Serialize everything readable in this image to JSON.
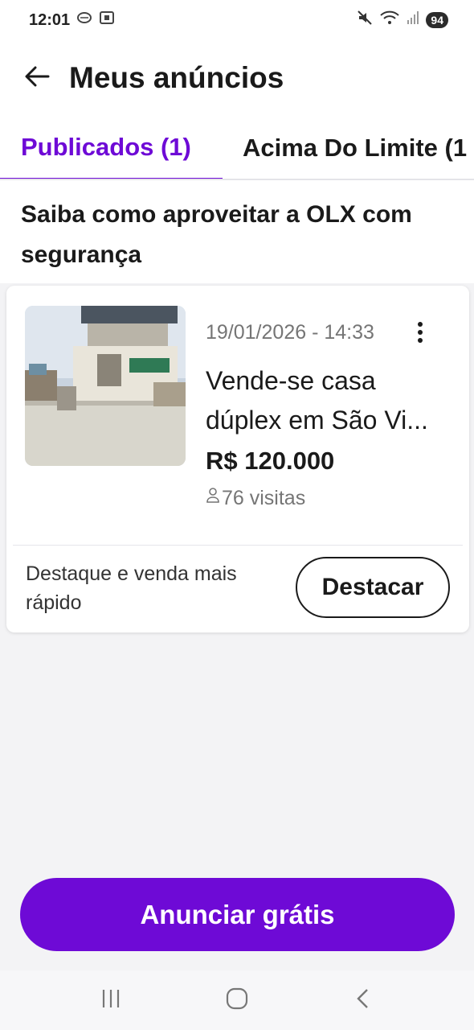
{
  "status_bar": {
    "time": "12:01",
    "battery": "94"
  },
  "header": {
    "title": "Meus anúncios",
    "back_icon": "arrow-left-icon"
  },
  "tabs": [
    {
      "label": "Publicados (1)",
      "active": true
    },
    {
      "label": "Acima Do Limite (1",
      "active": false
    }
  ],
  "info": {
    "text": "Saiba como aproveitar a OLX com segurança"
  },
  "ad": {
    "date": "19/01/2026 - 14:33",
    "title_line1": "Vende-se casa",
    "title_line2": "dúplex em São Vi...",
    "price": "R$ 120.000",
    "visits": "76 visitas",
    "promo_text": "Destaque e venda mais rápido",
    "promo_button": "Destacar"
  },
  "cta": {
    "label": "Anunciar grátis"
  },
  "colors": {
    "accent": "#6e0ad6",
    "background": "#f3f3f5"
  }
}
